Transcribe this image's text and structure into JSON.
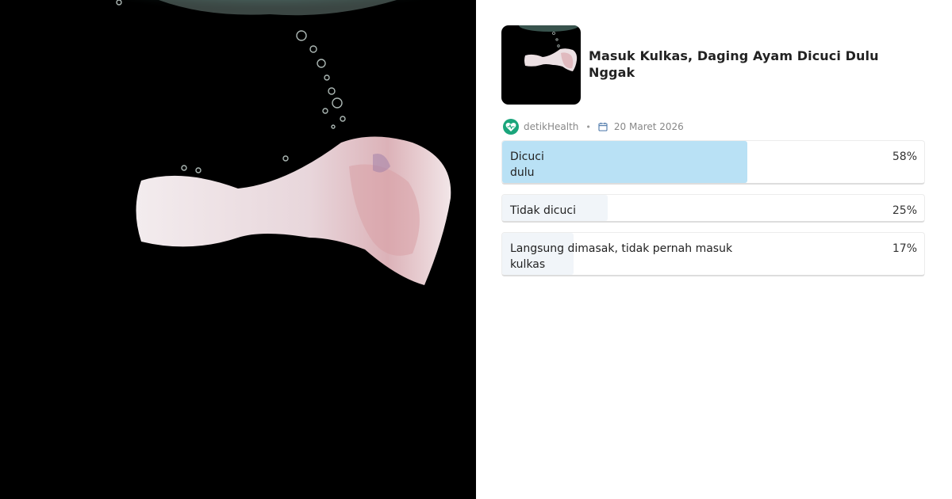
{
  "poll": {
    "title": "Masuk Kulkas, Daging Ayam Dicuci Dulu Nggak",
    "source": "detikHealth",
    "separator": "•",
    "date": "20 Maret 2026",
    "options": [
      {
        "label": "Dicuci\ndulu",
        "percent": 58,
        "percent_label": "58%",
        "leading": true
      },
      {
        "label": "Tidak dicuci",
        "percent": 25,
        "percent_label": "25%",
        "leading": false
      },
      {
        "label": "Langsung dimasak, tidak pernah masuk\nkulkas",
        "percent": 17,
        "percent_label": "17%",
        "leading": false
      }
    ]
  },
  "icons": {
    "logo": "heart-pulse-icon",
    "date": "calendar-icon"
  },
  "colors": {
    "hero_background": "#000000",
    "leading_fill": "#b9e1f5",
    "other_fill": "#f1f5f9",
    "brand_green": "#1aa57b"
  }
}
